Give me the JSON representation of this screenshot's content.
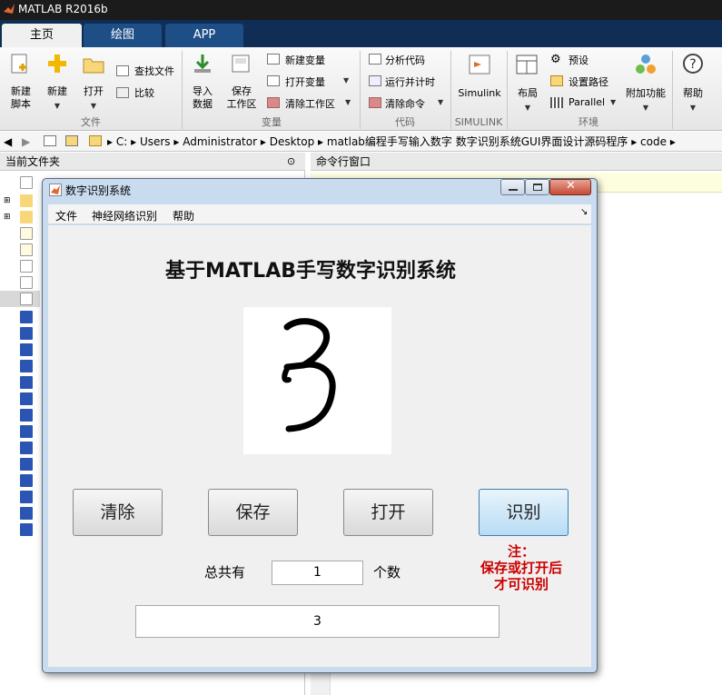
{
  "app": {
    "title": "MATLAB R2016b"
  },
  "tabs": [
    "主页",
    "绘图",
    "APP"
  ],
  "ribbon": {
    "file": {
      "group": "文件",
      "new_script": [
        "新建",
        "脚本"
      ],
      "new": "新建",
      "open": "打开",
      "find_files": "查找文件",
      "compare": "比较"
    },
    "variable": {
      "group": "变量",
      "import": [
        "导入",
        "数据"
      ],
      "save_ws": [
        "保存",
        "工作区"
      ],
      "new_var": "新建变量",
      "open_var": "打开变量",
      "clear_ws": "清除工作区"
    },
    "code": {
      "group": "代码",
      "analyze": "分析代码",
      "run_time": "运行并计时",
      "clear_cmd": "清除命令"
    },
    "simulink": {
      "group": "SIMULINK",
      "label": "Simulink"
    },
    "env": {
      "group": "环境",
      "layout": "布局",
      "prefs": "预设",
      "set_path": "设置路径",
      "parallel": "Parallel",
      "addons": "附加功能"
    },
    "help": "帮助"
  },
  "addressbar": {
    "path": [
      "C:",
      "Users",
      "Administrator",
      "Desktop",
      "matlab编程手写输入数字 数字识别系统GUI界面设计源码程序",
      "code"
    ]
  },
  "panels": {
    "current_folder": "当前文件夹",
    "command_window": "命令行窗口"
  },
  "dialog": {
    "title": "数字识别系统",
    "menu": [
      "文件",
      "神经网络识别",
      "帮助"
    ],
    "heading": "基于MATLAB手写数字识别系统",
    "buttons": {
      "clear": "清除",
      "save": "保存",
      "open": "打开",
      "recognize": "识别"
    },
    "count_label": "总共有",
    "count_value": "1",
    "count_unit": "个数",
    "note": [
      "注：",
      "保存或打开后",
      "才可识别"
    ],
    "result": "3"
  },
  "colors": {
    "note": "#cc0000",
    "tab_bar": "#0f2d55"
  }
}
